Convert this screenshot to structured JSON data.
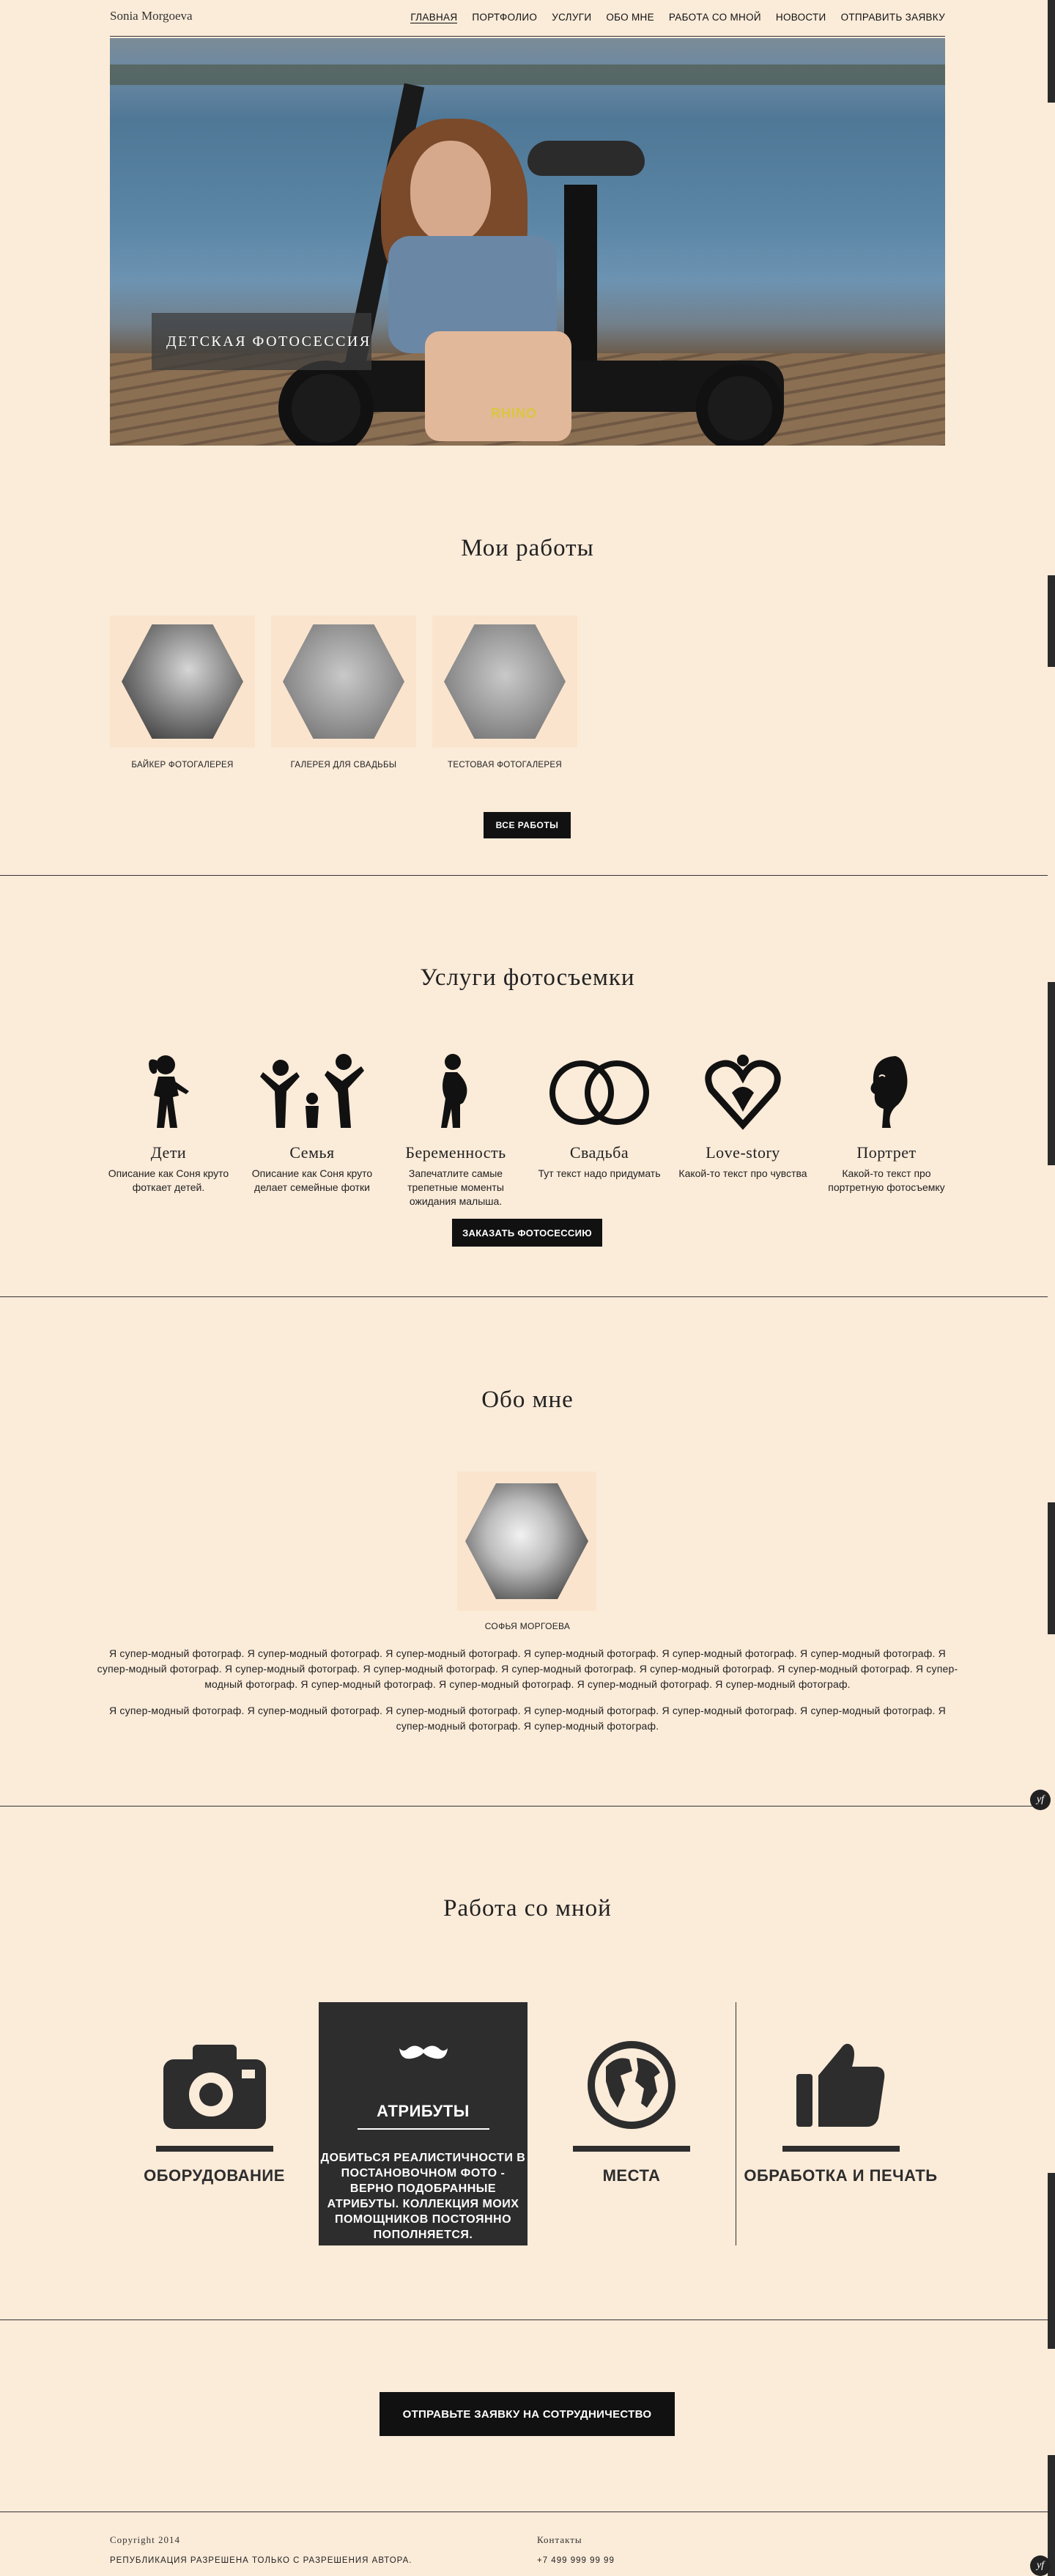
{
  "header": {
    "brand": "Sonia Morgoeva",
    "nav": [
      "ГЛАВНАЯ",
      "ПОРТФОЛИО",
      "УСЛУГИ",
      "ОБО МНЕ",
      "РАБОТА СО МНОЙ",
      "НОВОСТИ",
      "ОТПРАВИТЬ ЗАЯВКУ"
    ]
  },
  "hero": {
    "caption": "ДЕТСКАЯ ФОТОСЕССИЯ",
    "scooter_brand": "RHINO"
  },
  "portfolio": {
    "title": "Мои работы",
    "items": [
      {
        "label": "БАЙКЕР ФОТОГАЛЕРЕЯ"
      },
      {
        "label": "ГАЛЕРЕЯ ДЛЯ СВАДЬБЫ"
      },
      {
        "label": "ТЕСТОВАЯ ФОТОГАЛЕРЕЯ"
      }
    ],
    "all_button": "ВСЕ РАБОТЫ"
  },
  "services": {
    "title": "Услуги фотосъемки",
    "items": [
      {
        "name": "Дети",
        "desc": "Описание как Соня круто фоткает детей.",
        "icon": "child-icon"
      },
      {
        "name": "Семья",
        "desc": "Описание как Соня круто делает семейные фотки",
        "icon": "family-icon"
      },
      {
        "name": "Беременность",
        "desc": "Запечатлите самые трепетные моменты ожидания малыша.",
        "icon": "pregnancy-icon"
      },
      {
        "name": "Свадьба",
        "desc": "Тут текст надо придумать",
        "icon": "rings-icon"
      },
      {
        "name": "Love-story",
        "desc": "Какой-то текст про чувства",
        "icon": "heart-icon"
      },
      {
        "name": "Портрет",
        "desc": "Какой-то текст про портретную фотосъемку",
        "icon": "portrait-icon"
      }
    ],
    "order_button": "ЗАКАЗАТЬ ФОТОСЕССИЮ"
  },
  "about": {
    "title": "Обо мне",
    "name": "СОФЬЯ МОРГОЕВА",
    "paragraph1": "Я супер-модный фотограф. Я супер-модный фотограф. Я супер-модный фотограф. Я супер-модный фотограф. Я супер-модный фотограф. Я супер-модный фотограф. Я супер-модный фотограф. Я супер-модный фотограф. Я супер-модный фотограф. Я супер-модный фотограф. Я супер-модный фотограф. Я супер-модный фотограф. Я супер-модный фотограф. Я супер-модный фотограф. Я супер-модный фотограф. Я супер-модный фотограф. Я супер-модный фотограф.",
    "paragraph2": "Я супер-модный фотограф. Я супер-модный фотограф. Я супер-модный фотограф. Я супер-модный фотограф. Я супер-модный фотограф. Я супер-модный фотограф. Я супер-модный фотограф. Я супер-модный фотограф."
  },
  "work_with_me": {
    "title": "Работа со мной",
    "items": [
      {
        "title": "ОБОРУДОВАНИЕ",
        "icon": "camera-icon"
      },
      {
        "title": "АТРИБУТЫ",
        "icon": "mustache-icon",
        "desc": "ДОБИТЬСЯ РЕАЛИСТИЧНОСТИ В ПОСТАНОВОЧНОМ ФОТО - ВЕРНО ПОДОБРАННЫЕ АТРИБУТЫ. КОЛЛЕКЦИЯ МОИХ ПОМОЩНИКОВ ПОСТОЯННО ПОПОЛНЯЕТСЯ."
      },
      {
        "title": "МЕСТА",
        "icon": "globe-icon"
      },
      {
        "title": "ОБРАБОТКА И ПЕЧАТЬ",
        "icon": "thumbs-up-icon"
      }
    ]
  },
  "cta": {
    "button": "ОТПРАВЬТЕ ЗАЯВКУ НА СОТРУДНИЧЕСТВО"
  },
  "footer": {
    "copyright": "Copyright 2014",
    "notice": "РЕПУБЛИКАЦИЯ РАЗРЕШЕНА ТОЛЬКО С РАЗРЕШЕНИЯ АВТОРА.",
    "contacts_title": "Контакты",
    "phone": "+7 499 999 99 99"
  },
  "widget": {
    "label": "yf"
  },
  "colors": {
    "background": "#fbebd9",
    "dark": "#2d2d2d",
    "thumb_bg": "#fbe4cd"
  }
}
